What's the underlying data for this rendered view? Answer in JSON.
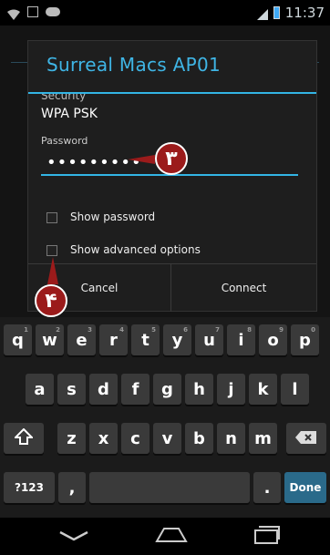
{
  "status_bar": {
    "time": "11:37"
  },
  "dialog": {
    "title": "Surreal Macs AP01",
    "security_label": "Security",
    "security_value": "WPA PSK",
    "password_label": "Password",
    "password_value": "•••••••••",
    "show_password_label": "Show password",
    "show_advanced_label": "Show advanced options",
    "cancel_label": "Cancel",
    "connect_label": "Connect"
  },
  "annotations": {
    "callout_3": "۳",
    "callout_4": "۴"
  },
  "keyboard": {
    "row1": [
      "q",
      "w",
      "e",
      "r",
      "t",
      "y",
      "u",
      "i",
      "o",
      "p"
    ],
    "row1_hints": [
      "1",
      "2",
      "3",
      "4",
      "5",
      "6",
      "7",
      "8",
      "9",
      "0"
    ],
    "row2": [
      "a",
      "s",
      "d",
      "f",
      "g",
      "h",
      "j",
      "k",
      "l"
    ],
    "row3": [
      "z",
      "x",
      "c",
      "v",
      "b",
      "n",
      "m"
    ],
    "symbols_label": "?123",
    "comma_label": ",",
    "period_label": ".",
    "done_label": "Done"
  },
  "colors": {
    "accent": "#33b5e5",
    "callout": "#9b1b1b"
  }
}
